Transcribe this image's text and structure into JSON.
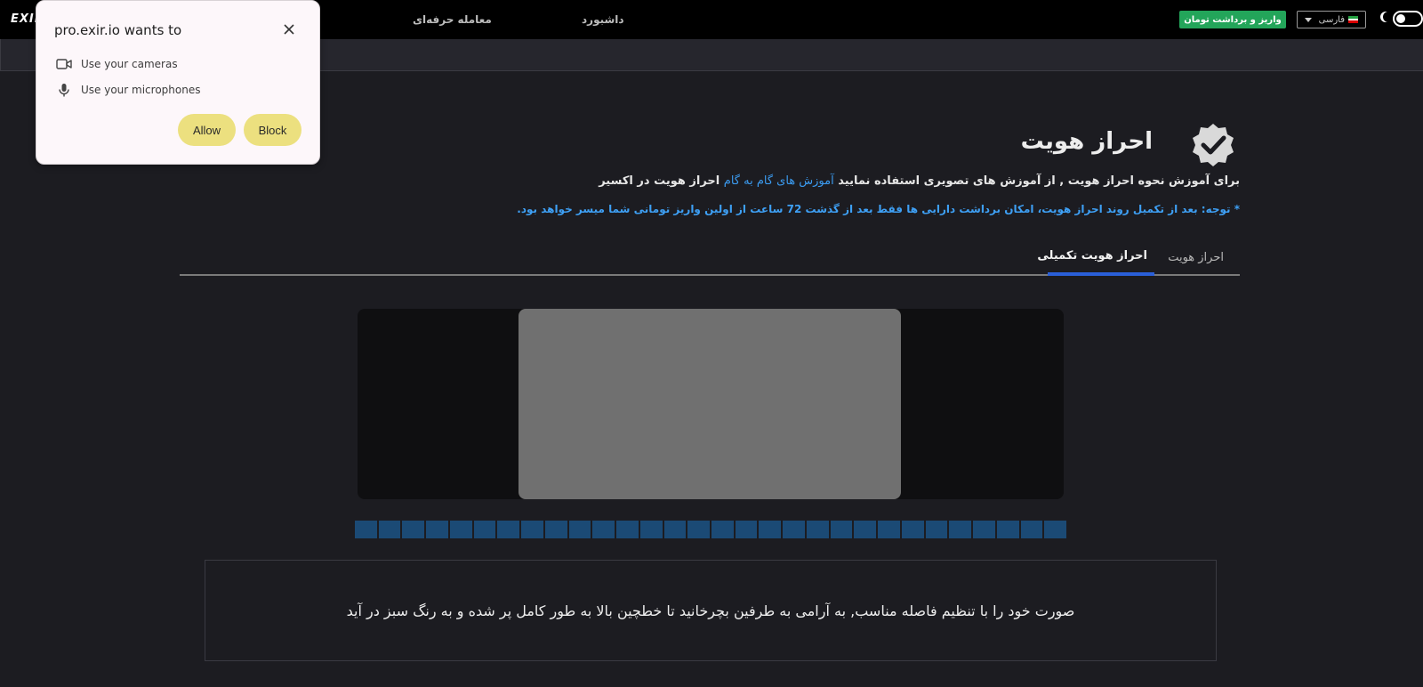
{
  "topbar": {
    "logo": "EXIR",
    "nav": {
      "pro_trade": "معامله حرفه‌ای",
      "dashboard": "داشبورد"
    },
    "toman_button": "واریز و برداشت تومان",
    "language": "فارسی",
    "accent_green": "#23a55a"
  },
  "page": {
    "title": "احراز هویت",
    "intro": {
      "before": "برای آموزش نحوه احراز هویت , از آموزش های تصویری استفاده نمایید ",
      "link": " آموزش های گام به گام",
      "after": " احراز هویت در اکسیر"
    },
    "notice": "* توجه: بعد از تکمیل روند احراز هویت، امکان برداشت دارایی ها فقط بعد از گذشت 72 ساعت از اولین واریز تومانی شما میسر خواهد بود.",
    "tabs": {
      "basic": "احراز هویت",
      "advanced": "احراز هویت تکمیلی"
    },
    "progress_cells": 30,
    "instruction": "صورت خود را با تنظیم فاصله مناسب, به آرامی به طرفین بچرخانید تا خطچین بالا به طور کامل پر شده و به رنگ سبز در آید"
  },
  "permission": {
    "title": "pro.exir.io wants to",
    "items": [
      {
        "icon": "camera-icon",
        "label": "Use your cameras"
      },
      {
        "icon": "microphone-icon",
        "label": "Use your microphones"
      }
    ],
    "allow": "Allow",
    "block": "Block"
  }
}
